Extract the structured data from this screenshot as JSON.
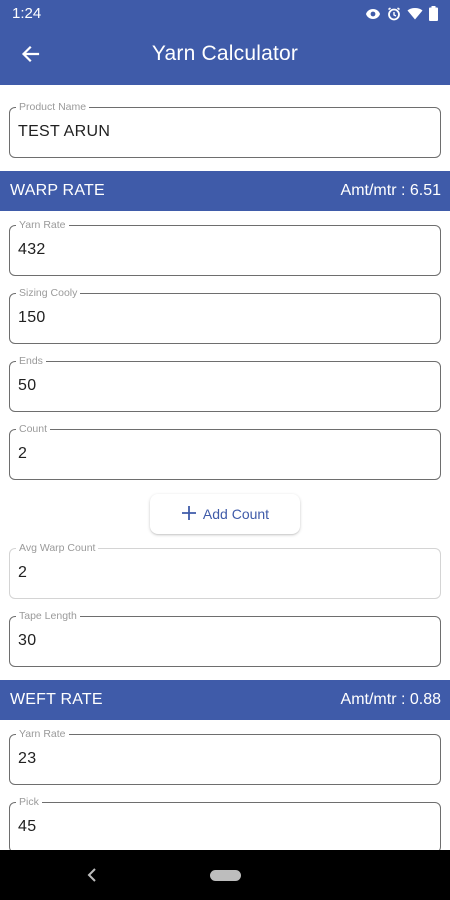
{
  "status": {
    "time": "1:24"
  },
  "app_bar": {
    "title": "Yarn Calculator"
  },
  "product": {
    "label": "Product Name",
    "value": "TEST ARUN"
  },
  "warp": {
    "title": "WARP RATE",
    "amount": "Amt/mtr : 6.51",
    "fields": {
      "yarn_rate": {
        "label": "Yarn Rate",
        "value": "432"
      },
      "sizing_cooly": {
        "label": "Sizing Cooly",
        "value": "150"
      },
      "ends": {
        "label": "Ends",
        "value": "50"
      },
      "count": {
        "label": "Count",
        "value": "2"
      },
      "avg_warp_count": {
        "label": "Avg Warp Count",
        "value": "2"
      },
      "tape_length": {
        "label": "Tape Length",
        "value": "30"
      }
    },
    "add_count_label": "Add Count"
  },
  "weft": {
    "title": "WEFT RATE",
    "amount": "Amt/mtr : 0.88",
    "fields": {
      "yarn_rate": {
        "label": "Yarn Rate",
        "value": "23"
      },
      "pick": {
        "label": "Pick",
        "value": "45"
      }
    }
  },
  "colors": {
    "primary": "#3f5ba9",
    "nav_bar": "#000000"
  },
  "icons": {
    "back": "arrow-left-icon",
    "add": "plus-icon",
    "status": [
      "eye-icon",
      "alarm-icon",
      "wifi-icon",
      "battery-icon"
    ],
    "nav": [
      "nav-back-icon",
      "nav-home-pill"
    ]
  }
}
